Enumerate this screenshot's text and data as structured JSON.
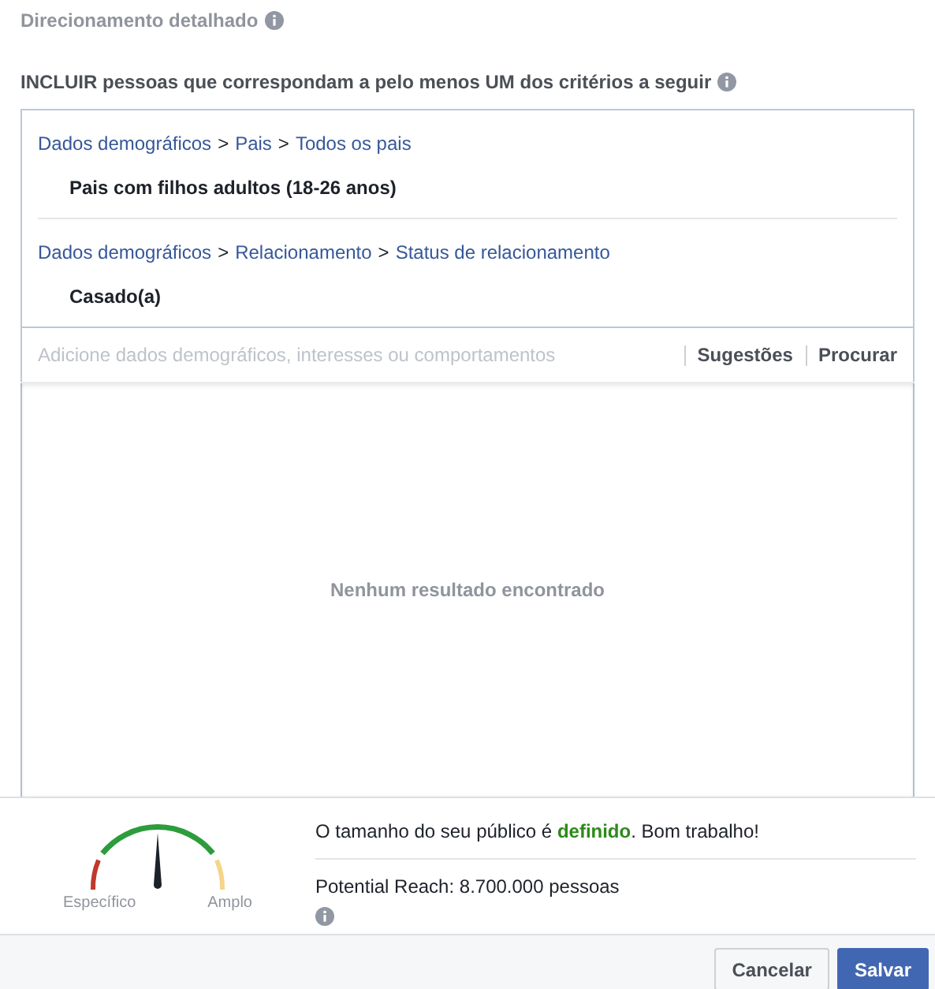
{
  "heading": {
    "title": "Direcionamento detalhado"
  },
  "include_label": "INCLUIR pessoas que correspondam a pelo menos UM dos critérios a seguir",
  "criteria": [
    {
      "path": [
        {
          "kind": "link",
          "text": "Dados demográficos"
        },
        {
          "kind": "separator",
          "text": ">"
        },
        {
          "kind": "link",
          "text": "Pais"
        },
        {
          "kind": "separator",
          "text": ">"
        },
        {
          "kind": "link",
          "text": "Todos os pais"
        }
      ],
      "value": "Pais com filhos adultos (18-26 anos)"
    },
    {
      "path": [
        {
          "kind": "link",
          "text": "Dados demográficos"
        },
        {
          "kind": "separator",
          "text": ">"
        },
        {
          "kind": "link",
          "text": "Relacionamento"
        },
        {
          "kind": "separator",
          "text": ">"
        },
        {
          "kind": "link",
          "text": "Status de relacionamento"
        }
      ],
      "value": "Casado(a)"
    }
  ],
  "search": {
    "placeholder": "Adicione dados demográficos, interesses ou comportamentos",
    "actions": [
      "Sugestões",
      "Procurar"
    ]
  },
  "results": {
    "empty_message": "Nenhum resultado encontrado"
  },
  "audience": {
    "gauge": {
      "low_label": "Específico",
      "high_label": "Amplo"
    },
    "message": "O tamanho do seu público é **definido**. Bom trabalho!",
    "reach": "Potential Reach: 8.700.000 pessoas"
  },
  "buttons": [
    {
      "label": "Cancelar",
      "kind": "secondary"
    },
    {
      "label": "Salvar",
      "kind": "primary"
    }
  ]
}
